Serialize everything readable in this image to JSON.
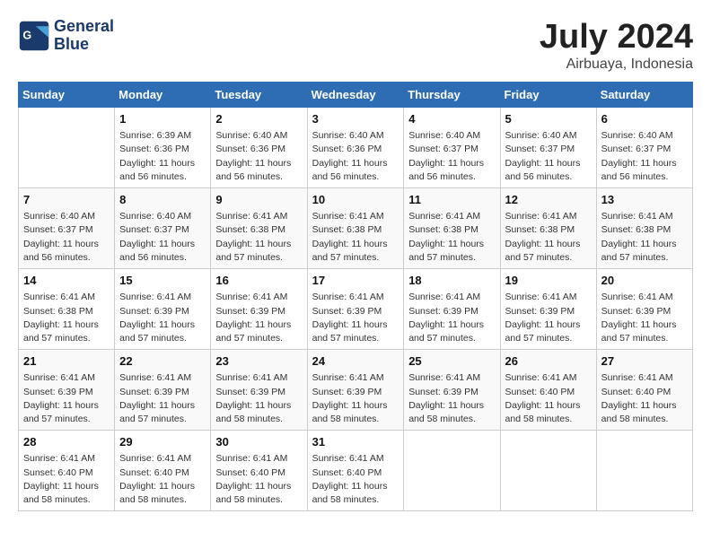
{
  "header": {
    "logo_line1": "General",
    "logo_line2": "Blue",
    "title": "July 2024",
    "subtitle": "Airbuaya, Indonesia"
  },
  "columns": [
    "Sunday",
    "Monday",
    "Tuesday",
    "Wednesday",
    "Thursday",
    "Friday",
    "Saturday"
  ],
  "weeks": [
    [
      {
        "day": "",
        "content": ""
      },
      {
        "day": "1",
        "content": "Sunrise: 6:39 AM\nSunset: 6:36 PM\nDaylight: 11 hours\nand 56 minutes."
      },
      {
        "day": "2",
        "content": "Sunrise: 6:40 AM\nSunset: 6:36 PM\nDaylight: 11 hours\nand 56 minutes."
      },
      {
        "day": "3",
        "content": "Sunrise: 6:40 AM\nSunset: 6:36 PM\nDaylight: 11 hours\nand 56 minutes."
      },
      {
        "day": "4",
        "content": "Sunrise: 6:40 AM\nSunset: 6:37 PM\nDaylight: 11 hours\nand 56 minutes."
      },
      {
        "day": "5",
        "content": "Sunrise: 6:40 AM\nSunset: 6:37 PM\nDaylight: 11 hours\nand 56 minutes."
      },
      {
        "day": "6",
        "content": "Sunrise: 6:40 AM\nSunset: 6:37 PM\nDaylight: 11 hours\nand 56 minutes."
      }
    ],
    [
      {
        "day": "7",
        "content": "Sunrise: 6:40 AM\nSunset: 6:37 PM\nDaylight: 11 hours\nand 56 minutes."
      },
      {
        "day": "8",
        "content": "Sunrise: 6:40 AM\nSunset: 6:37 PM\nDaylight: 11 hours\nand 56 minutes."
      },
      {
        "day": "9",
        "content": "Sunrise: 6:41 AM\nSunset: 6:38 PM\nDaylight: 11 hours\nand 57 minutes."
      },
      {
        "day": "10",
        "content": "Sunrise: 6:41 AM\nSunset: 6:38 PM\nDaylight: 11 hours\nand 57 minutes."
      },
      {
        "day": "11",
        "content": "Sunrise: 6:41 AM\nSunset: 6:38 PM\nDaylight: 11 hours\nand 57 minutes."
      },
      {
        "day": "12",
        "content": "Sunrise: 6:41 AM\nSunset: 6:38 PM\nDaylight: 11 hours\nand 57 minutes."
      },
      {
        "day": "13",
        "content": "Sunrise: 6:41 AM\nSunset: 6:38 PM\nDaylight: 11 hours\nand 57 minutes."
      }
    ],
    [
      {
        "day": "14",
        "content": "Sunrise: 6:41 AM\nSunset: 6:38 PM\nDaylight: 11 hours\nand 57 minutes."
      },
      {
        "day": "15",
        "content": "Sunrise: 6:41 AM\nSunset: 6:39 PM\nDaylight: 11 hours\nand 57 minutes."
      },
      {
        "day": "16",
        "content": "Sunrise: 6:41 AM\nSunset: 6:39 PM\nDaylight: 11 hours\nand 57 minutes."
      },
      {
        "day": "17",
        "content": "Sunrise: 6:41 AM\nSunset: 6:39 PM\nDaylight: 11 hours\nand 57 minutes."
      },
      {
        "day": "18",
        "content": "Sunrise: 6:41 AM\nSunset: 6:39 PM\nDaylight: 11 hours\nand 57 minutes."
      },
      {
        "day": "19",
        "content": "Sunrise: 6:41 AM\nSunset: 6:39 PM\nDaylight: 11 hours\nand 57 minutes."
      },
      {
        "day": "20",
        "content": "Sunrise: 6:41 AM\nSunset: 6:39 PM\nDaylight: 11 hours\nand 57 minutes."
      }
    ],
    [
      {
        "day": "21",
        "content": "Sunrise: 6:41 AM\nSunset: 6:39 PM\nDaylight: 11 hours\nand 57 minutes."
      },
      {
        "day": "22",
        "content": "Sunrise: 6:41 AM\nSunset: 6:39 PM\nDaylight: 11 hours\nand 57 minutes."
      },
      {
        "day": "23",
        "content": "Sunrise: 6:41 AM\nSunset: 6:39 PM\nDaylight: 11 hours\nand 58 minutes."
      },
      {
        "day": "24",
        "content": "Sunrise: 6:41 AM\nSunset: 6:39 PM\nDaylight: 11 hours\nand 58 minutes."
      },
      {
        "day": "25",
        "content": "Sunrise: 6:41 AM\nSunset: 6:39 PM\nDaylight: 11 hours\nand 58 minutes."
      },
      {
        "day": "26",
        "content": "Sunrise: 6:41 AM\nSunset: 6:40 PM\nDaylight: 11 hours\nand 58 minutes."
      },
      {
        "day": "27",
        "content": "Sunrise: 6:41 AM\nSunset: 6:40 PM\nDaylight: 11 hours\nand 58 minutes."
      }
    ],
    [
      {
        "day": "28",
        "content": "Sunrise: 6:41 AM\nSunset: 6:40 PM\nDaylight: 11 hours\nand 58 minutes."
      },
      {
        "day": "29",
        "content": "Sunrise: 6:41 AM\nSunset: 6:40 PM\nDaylight: 11 hours\nand 58 minutes."
      },
      {
        "day": "30",
        "content": "Sunrise: 6:41 AM\nSunset: 6:40 PM\nDaylight: 11 hours\nand 58 minutes."
      },
      {
        "day": "31",
        "content": "Sunrise: 6:41 AM\nSunset: 6:40 PM\nDaylight: 11 hours\nand 58 minutes."
      },
      {
        "day": "",
        "content": ""
      },
      {
        "day": "",
        "content": ""
      },
      {
        "day": "",
        "content": ""
      }
    ]
  ]
}
